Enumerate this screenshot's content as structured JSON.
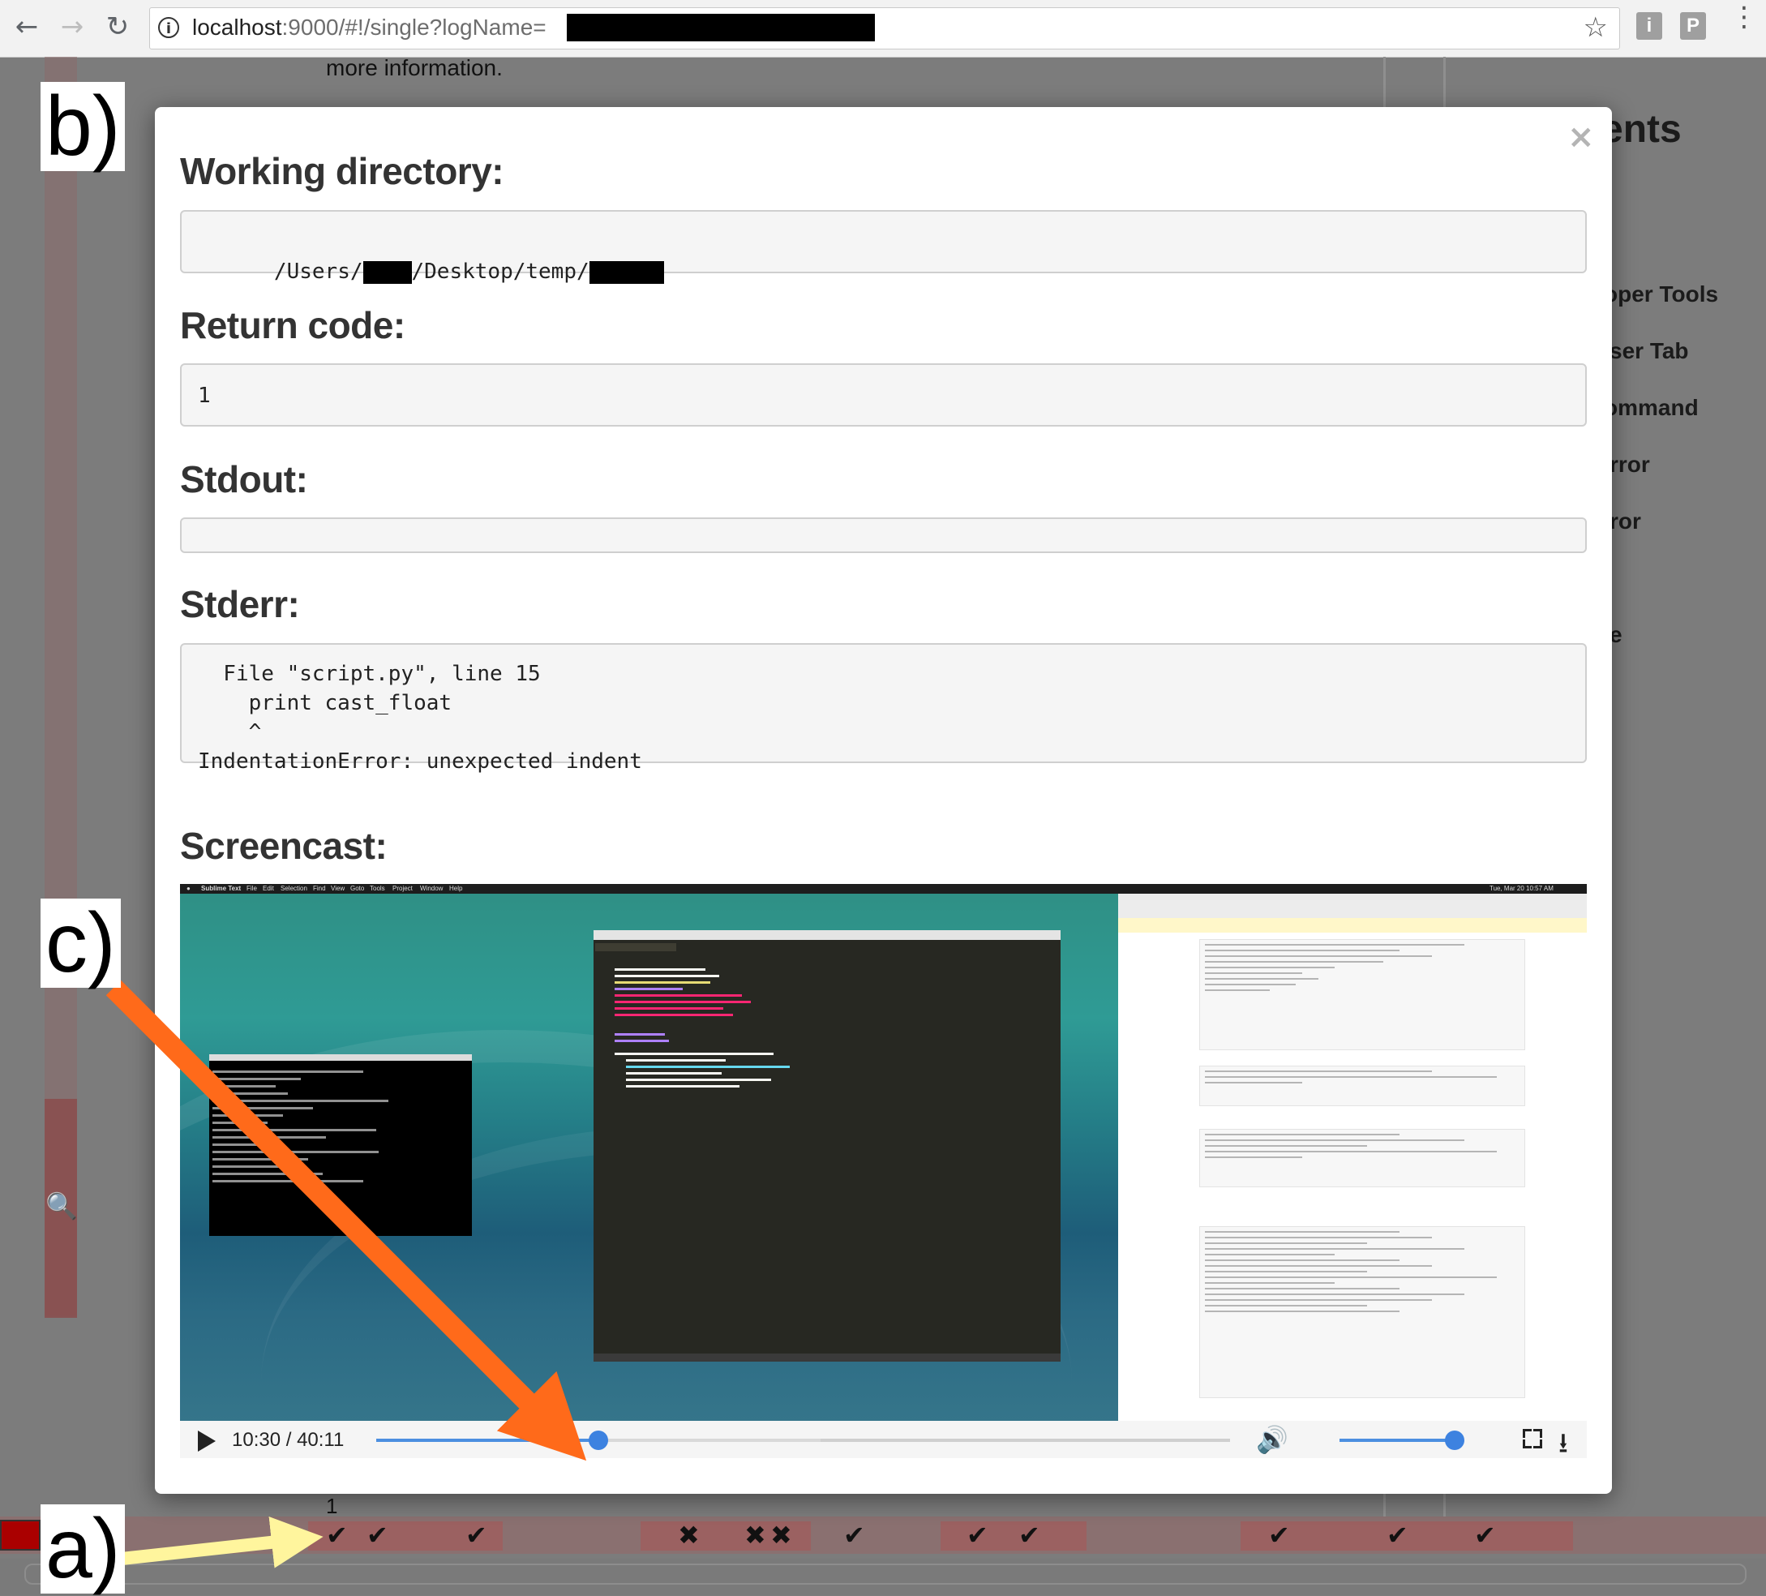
{
  "browser": {
    "url_host": "localhost",
    "url_rest": ":9000/#!/single?logName=",
    "ext_i": "i",
    "ext_p": "P"
  },
  "background": {
    "more_info": "more information.",
    "right_heading": "ents",
    "right_items": [
      "oper Tools",
      "ser Tab",
      "ommand",
      "rror",
      "ror",
      "e"
    ],
    "strip_number": "1",
    "strip_marks": [
      "✔",
      "✔",
      "✔",
      "✔",
      "✖",
      "✖",
      "✖",
      "✔",
      "✔",
      "✔",
      "✔",
      "✔",
      "✔"
    ]
  },
  "modal": {
    "close_label": "×",
    "working_directory": {
      "label": "Working directory:",
      "value_prefix": "/Users/",
      "value_middle": "/Desktop/temp/"
    },
    "return_code": {
      "label": "Return code:",
      "value": "1"
    },
    "stdout": {
      "label": "Stdout:",
      "value": ""
    },
    "stderr": {
      "label": "Stderr:",
      "value": "  File \"script.py\", line 15\n    print cast_float\n    ^\nIndentationError: unexpected indent"
    },
    "screencast": {
      "label": "Screencast:",
      "time": "10:30 / 40:11",
      "progress": 0.26,
      "buffered": 0.52,
      "volume": 1.0,
      "menubar_app": "Sublime Text",
      "menubar_items": [
        "File",
        "Edit",
        "Selection",
        "Find",
        "View",
        "Goto",
        "Tools",
        "Project",
        "Window",
        "Help"
      ],
      "menubar_clock": "Tue, Mar 20 10:57 AM"
    }
  },
  "annotations": {
    "a": "a)",
    "b": "b)",
    "c": "c)",
    "arrow_a_color": "#fff59d",
    "arrow_c_color": "#ff6a1a"
  }
}
